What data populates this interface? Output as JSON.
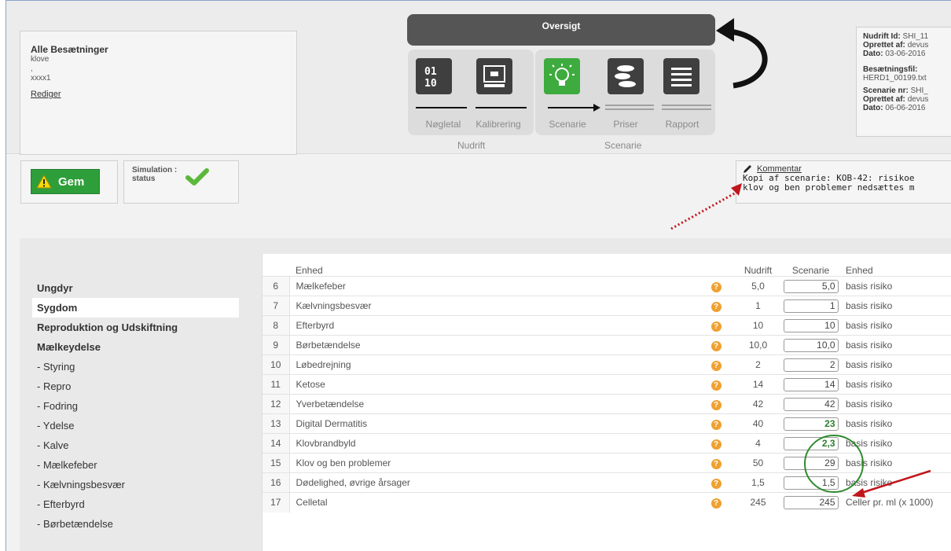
{
  "crew": {
    "title": "Alle Besætninger",
    "line1": "klove",
    "line2": ",",
    "line3": "xxxx1",
    "edit_label": "Rediger"
  },
  "overview": {
    "title": "Oversigt",
    "steps": [
      {
        "label": "Nøgletal",
        "icon": "binary-icon"
      },
      {
        "label": "Kalibrering",
        "icon": "scale-icon"
      },
      {
        "label": "Scenarie",
        "icon": "lightbulb-icon"
      },
      {
        "label": "Priser",
        "icon": "coins-icon"
      },
      {
        "label": "Rapport",
        "icon": "list-icon"
      }
    ],
    "group_nudrift": "Nudrift",
    "group_scenarie": "Scenarie"
  },
  "meta": {
    "nudrift_id_label": "Nudrift Id:",
    "nudrift_id": "SHI_11",
    "created_by_label": "Oprettet af:",
    "created_by": "devus",
    "date_label": "Dato:",
    "date": "03-06-2016",
    "herd_file_label": "Besætningsfil:",
    "herd_file": "HERD1_00199.txt",
    "scenario_label": "Scenarie nr:",
    "scenario_nr": "SHI_",
    "created_by2_label": "Oprettet af:",
    "created_by2": "devus",
    "date2_label": "Dato:",
    "date2": "06-06-2016"
  },
  "actions": {
    "save_label": "Gem",
    "sim_label1": "Simulation :",
    "sim_label2": "status"
  },
  "comment": {
    "title": "Kommentar",
    "line1": "Kopi af scenarie: KOB-42: risikoe",
    "line2": "klov og ben problemer nedsættes m"
  },
  "sidebar": {
    "items": [
      {
        "label": "Ungdyr"
      },
      {
        "label": "Sygdom"
      },
      {
        "label": "Reproduktion og Udskiftning"
      },
      {
        "label": "Mælkeydelse"
      },
      {
        "label": "- Styring"
      },
      {
        "label": "- Repro"
      },
      {
        "label": "- Fodring"
      },
      {
        "label": "- Ydelse"
      },
      {
        "label": "- Kalve"
      },
      {
        "label": "- Mælkefeber"
      },
      {
        "label": "- Kælvningsbesvær"
      },
      {
        "label": "- Efterbyrd"
      },
      {
        "label": "- Børbetændelse"
      }
    ]
  },
  "table": {
    "headers": {
      "name": "Enhed",
      "nudrift": "Nudrift",
      "scenarie": "Scenarie",
      "unit": "Enhed"
    },
    "rows": [
      {
        "num": "6",
        "name": "Mælkefeber",
        "nudrift": "5,0",
        "scenarie": "5,0",
        "unit": "basis risiko"
      },
      {
        "num": "7",
        "name": "Kælvningsbesvær",
        "nudrift": "1",
        "scenarie": "1",
        "unit": "basis risiko"
      },
      {
        "num": "8",
        "name": "Efterbyrd",
        "nudrift": "10",
        "scenarie": "10",
        "unit": "basis risiko"
      },
      {
        "num": "9",
        "name": "Børbetændelse",
        "nudrift": "10,0",
        "scenarie": "10,0",
        "unit": "basis risiko"
      },
      {
        "num": "10",
        "name": "Løbedrejning",
        "nudrift": "2",
        "scenarie": "2",
        "unit": "basis risiko"
      },
      {
        "num": "11",
        "name": "Ketose",
        "nudrift": "14",
        "scenarie": "14",
        "unit": "basis risiko"
      },
      {
        "num": "12",
        "name": "Yverbetændelse",
        "nudrift": "42",
        "scenarie": "42",
        "unit": "basis risiko"
      },
      {
        "num": "13",
        "name": "Digital Dermatitis",
        "nudrift": "40",
        "scenarie": "23",
        "unit": "basis risiko"
      },
      {
        "num": "14",
        "name": "Klovbrandbyld",
        "nudrift": "4",
        "scenarie": "2,3",
        "unit": "basis risiko"
      },
      {
        "num": "15",
        "name": "Klov og ben problemer",
        "nudrift": "50",
        "scenarie": "29",
        "unit": "basis risiko"
      },
      {
        "num": "16",
        "name": "Dødelighed, øvrige årsager",
        "nudrift": "1,5",
        "scenarie": "1,5",
        "unit": "basis risiko"
      },
      {
        "num": "17",
        "name": "Celletal",
        "nudrift": "245",
        "scenarie": "245",
        "unit": "Celler pr. ml (x 1000)"
      }
    ],
    "help_symbol": "?"
  },
  "colors": {
    "accent_green": "#2e9e3a",
    "active_step": "#3dab3d",
    "annotation_red": "#c0161c",
    "circle_green": "#2e8b2e"
  }
}
